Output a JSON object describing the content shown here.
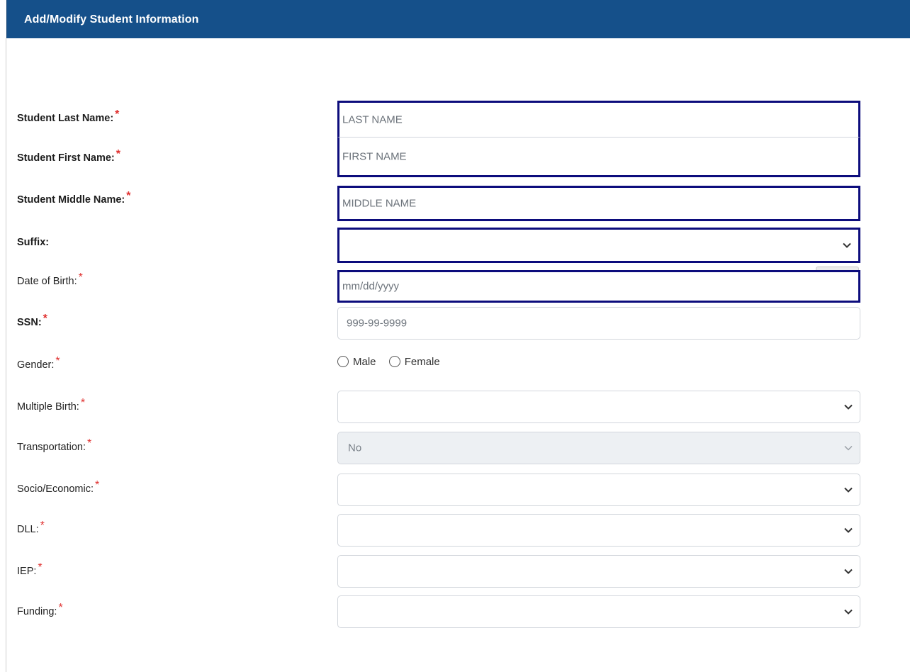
{
  "header": {
    "title": "Add/Modify Student Information"
  },
  "required_marker": "*",
  "fields": {
    "last_name": {
      "label": "Student Last Name:",
      "placeholder": "LAST NAME"
    },
    "first_name": {
      "label": "Student First Name:",
      "placeholder": "FIRST NAME"
    },
    "middle_name": {
      "label": "Student Middle Name:",
      "placeholder": "MIDDLE NAME"
    },
    "suffix": {
      "label": "Suffix:",
      "value": ""
    },
    "dob": {
      "label": "Date of Birth:",
      "placeholder": "mm/dd/yyyy"
    },
    "ssn": {
      "label": "SSN:",
      "placeholder": "999-99-9999"
    },
    "gender": {
      "label": "Gender:",
      "options": [
        "Male",
        "Female"
      ]
    },
    "multiple_birth": {
      "label": "Multiple Birth:",
      "value": ""
    },
    "transportation": {
      "label": "Transportation:",
      "value": "No"
    },
    "socio_economic": {
      "label": "Socio/Economic:",
      "value": ""
    },
    "dll": {
      "label": "DLL:",
      "value": ""
    },
    "iep": {
      "label": "IEP:",
      "value": ""
    },
    "funding": {
      "label": "Funding:",
      "value": ""
    }
  },
  "icons": {
    "dropdown": "chevron-down-icon",
    "calendar": "calendar-icon"
  },
  "colors": {
    "header_bg": "#15508a",
    "required": "#e0302f",
    "highlight_border": "#0c0c7c"
  }
}
